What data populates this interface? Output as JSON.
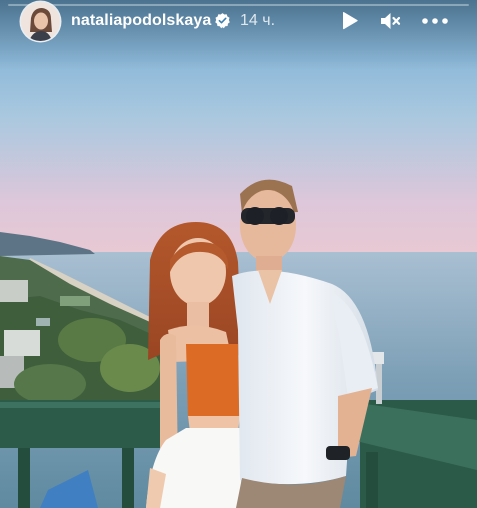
{
  "story": {
    "username": "nataliapodolskaya",
    "timestamp": "14 ч.",
    "progress_fraction": 0.0
  },
  "icons": {
    "avatar": "avatar-image",
    "verified": "verified-badge-icon",
    "play": "play-icon",
    "mute": "mute-icon",
    "more": "more-options-icon"
  },
  "colors": {
    "header_text": "#ffffff",
    "sky_top": "#79b1d6",
    "sky_bottom": "#e6c6d6",
    "sea": "#6d93aa",
    "railing": "#2b5a48"
  }
}
